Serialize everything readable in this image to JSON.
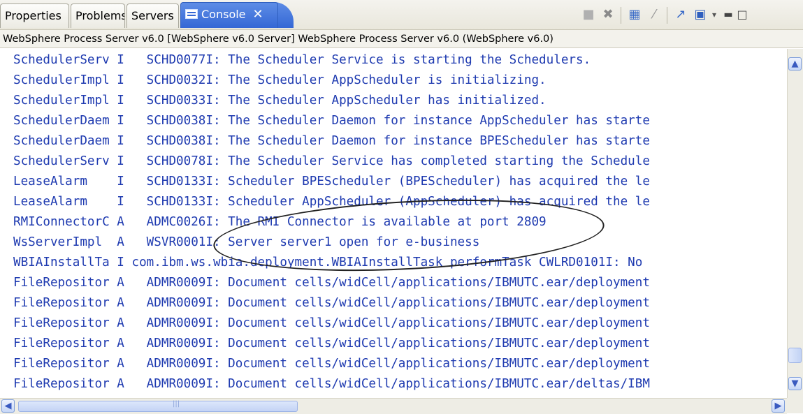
{
  "tabs": [
    {
      "label": "Properties",
      "active": false
    },
    {
      "label": "Problems",
      "active": false
    },
    {
      "label": "Servers",
      "active": false
    },
    {
      "label": "Console",
      "active": true
    }
  ],
  "tab_close_glyph": "✕",
  "toolbar": {
    "icons": [
      "terminate-icon",
      "remove-launches-icon",
      "scroll-lock-icon",
      "clear-console-icon",
      "pin-console-icon",
      "display-console-icon",
      "view-menu-icon",
      "minimize-icon",
      "maximize-icon"
    ]
  },
  "console_title": "WebSphere Process Server v6.0 [WebSphere v6.0 Server] WebSphere Process Server v6.0 (WebSphere v6.0)",
  "console_lines": [
    "SchedulerServ I   SCHD0077I: The Scheduler Service is starting the Schedulers.",
    "SchedulerImpl I   SCHD0032I: The Scheduler AppScheduler is initializing.",
    "SchedulerImpl I   SCHD0033I: The Scheduler AppScheduler has initialized.",
    "SchedulerDaem I   SCHD0038I: The Scheduler Daemon for instance AppScheduler has starte",
    "SchedulerDaem I   SCHD0038I: The Scheduler Daemon for instance BPEScheduler has starte",
    "SchedulerServ I   SCHD0078I: The Scheduler Service has completed starting the Schedule",
    "LeaseAlarm    I   SCHD0133I: Scheduler BPEScheduler (BPEScheduler) has acquired the le",
    "LeaseAlarm    I   SCHD0133I: Scheduler AppScheduler (AppScheduler) has acquired the le",
    "RMIConnectorC A   ADMC0026I: The RMI Connector is available at port 2809",
    "WsServerImpl  A   WSVR0001I: Server server1 open for e-business",
    "WBIAInstallTa I com.ibm.ws.wbia.deployment.WBIAInstallTask performTask CWLRD0101I: No",
    "FileRepositor A   ADMR0009I: Document cells/widCell/applications/IBMUTC.ear/deployment",
    "FileRepositor A   ADMR0009I: Document cells/widCell/applications/IBMUTC.ear/deployment",
    "FileRepositor A   ADMR0009I: Document cells/widCell/applications/IBMUTC.ear/deployment",
    "FileRepositor A   ADMR0009I: Document cells/widCell/applications/IBMUTC.ear/deployment",
    "FileRepositor A   ADMR0009I: Document cells/widCell/applications/IBMUTC.ear/deployment",
    "FileRepositor A   ADMR0009I: Document cells/widCell/applications/IBMUTC.ear/deltas/IBM"
  ],
  "colors": {
    "console_text": "#1e3ab0",
    "active_tab": "#3467d5"
  }
}
